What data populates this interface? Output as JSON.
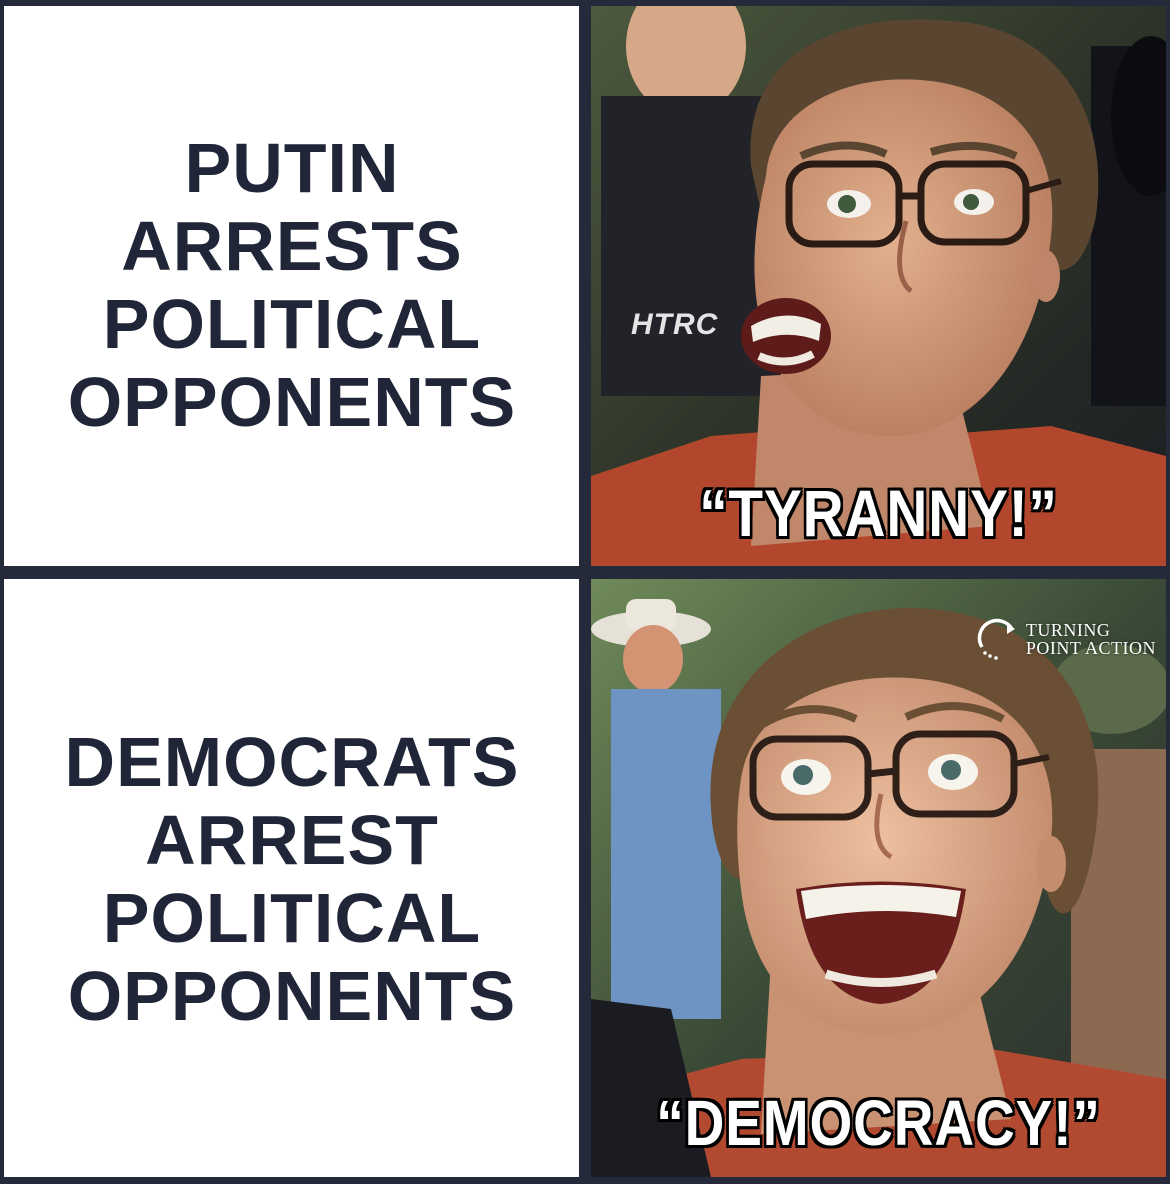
{
  "panels": [
    {
      "statement": "PUTIN\nARRESTS\nPOLITICAL\nOPPONENTS",
      "caption": "“TYRANNY!”",
      "reaction": "angry-shouting-woman"
    },
    {
      "statement": "DEMOCRATS\nARREST\nPOLITICAL\nOPPONENTS",
      "caption": "“DEMOCRACY!”",
      "reaction": "excited-smiling-woman"
    }
  ],
  "shirt_text": "HTRC",
  "watermark": {
    "line1": "TURNING",
    "line2": "POINT ACTION",
    "icon": "turning-point-arrow-icon"
  },
  "colors": {
    "text_navy": "#202638",
    "border_navy": "#242a3a",
    "caption_fill": "#ffffff",
    "caption_outline": "#000000"
  }
}
